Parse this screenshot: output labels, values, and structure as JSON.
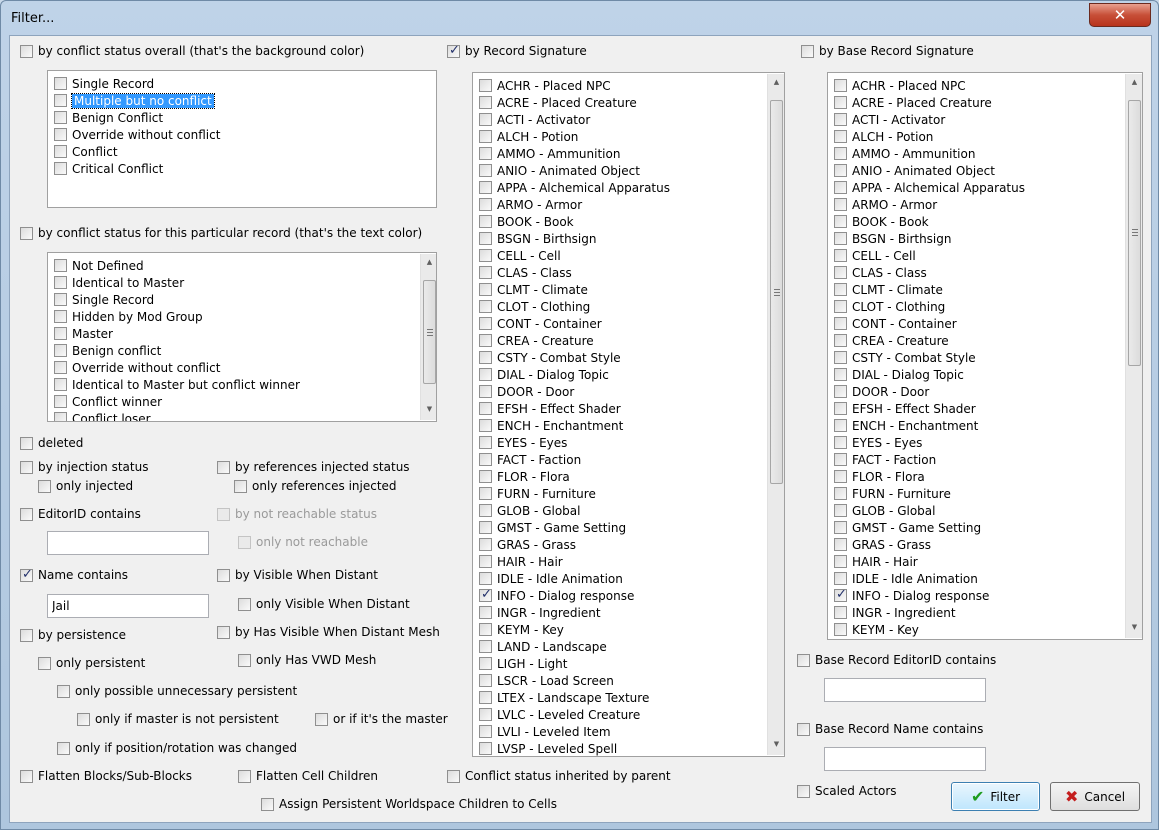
{
  "window": {
    "title": "Filter...",
    "close_glyph": "✕"
  },
  "conflict_overall": {
    "label": "by conflict status overall (that's the background color)",
    "checked": false,
    "items": [
      {
        "label": "Single Record",
        "selected": false
      },
      {
        "label": "Multiple but no conflict",
        "selected": true
      },
      {
        "label": "Benign Conflict",
        "selected": false
      },
      {
        "label": "Override without conflict",
        "selected": false
      },
      {
        "label": "Conflict",
        "selected": false
      },
      {
        "label": "Critical Conflict",
        "selected": false
      }
    ]
  },
  "conflict_record": {
    "label": "by conflict status for this particular record  (that's the text color)",
    "checked": false,
    "items": [
      "Not Defined",
      "Identical to Master",
      "Single Record",
      "Hidden by Mod Group",
      "Master",
      "Benign conflict",
      "Override without conflict",
      "Identical to Master but conflict winner",
      "Conflict winner",
      "Conflict loser"
    ]
  },
  "options": {
    "deleted": "deleted",
    "by_injection_status": "by injection status",
    "only_injected": "only injected",
    "by_references_injected": "by references injected status",
    "only_references_injected": "only references injected",
    "editorid_contains": "EditorID contains",
    "editorid_value": "",
    "by_not_reachable": "by not reachable status",
    "only_not_reachable": "only not reachable",
    "name_contains": "Name contains",
    "name_value": "Jail",
    "by_visible_when_distant": "by Visible When Distant",
    "only_visible_when_distant": "only Visible When Distant",
    "by_persistence": "by persistence",
    "by_has_vwd_mesh": "by Has Visible When Distant Mesh",
    "only_persistent": "only persistent",
    "only_has_vwd_mesh": "only Has VWD Mesh",
    "only_possible_unnecessary_persistent": "only possible unnecessary persistent",
    "only_if_master_not_persistent": "only if master is not persistent",
    "or_if_its_the_master": "or if it's the master",
    "only_if_position_changed": "only if position/rotation was changed",
    "flatten_blocks": "Flatten Blocks/Sub-Blocks",
    "flatten_cell_children": "Flatten Cell Children",
    "conflict_inherited": "Conflict status inherited by parent",
    "assign_persistent": "Assign Persistent Worldspace Children to Cells"
  },
  "record_signature": {
    "label": "by Record Signature",
    "checked": true,
    "items": [
      {
        "label": "ACHR - Placed NPC",
        "checked": false
      },
      {
        "label": "ACRE - Placed Creature",
        "checked": false
      },
      {
        "label": "ACTI - Activator",
        "checked": false
      },
      {
        "label": "ALCH - Potion",
        "checked": false
      },
      {
        "label": "AMMO - Ammunition",
        "checked": false
      },
      {
        "label": "ANIO - Animated Object",
        "checked": false
      },
      {
        "label": "APPA - Alchemical Apparatus",
        "checked": false
      },
      {
        "label": "ARMO - Armor",
        "checked": false
      },
      {
        "label": "BOOK - Book",
        "checked": false
      },
      {
        "label": "BSGN - Birthsign",
        "checked": false
      },
      {
        "label": "CELL - Cell",
        "checked": false
      },
      {
        "label": "CLAS - Class",
        "checked": false
      },
      {
        "label": "CLMT - Climate",
        "checked": false
      },
      {
        "label": "CLOT - Clothing",
        "checked": false
      },
      {
        "label": "CONT - Container",
        "checked": false
      },
      {
        "label": "CREA - Creature",
        "checked": false
      },
      {
        "label": "CSTY - Combat Style",
        "checked": false
      },
      {
        "label": "DIAL - Dialog Topic",
        "checked": false
      },
      {
        "label": "DOOR - Door",
        "checked": false
      },
      {
        "label": "EFSH - Effect Shader",
        "checked": false
      },
      {
        "label": "ENCH - Enchantment",
        "checked": false
      },
      {
        "label": "EYES - Eyes",
        "checked": false
      },
      {
        "label": "FACT - Faction",
        "checked": false
      },
      {
        "label": "FLOR - Flora",
        "checked": false
      },
      {
        "label": "FURN - Furniture",
        "checked": false
      },
      {
        "label": "GLOB - Global",
        "checked": false
      },
      {
        "label": "GMST - Game Setting",
        "checked": false
      },
      {
        "label": "GRAS - Grass",
        "checked": false
      },
      {
        "label": "HAIR - Hair",
        "checked": false
      },
      {
        "label": "IDLE - Idle Animation",
        "checked": false
      },
      {
        "label": "INFO - Dialog response",
        "checked": true
      },
      {
        "label": "INGR - Ingredient",
        "checked": false
      },
      {
        "label": "KEYM - Key",
        "checked": false
      },
      {
        "label": "LAND - Landscape",
        "checked": false
      },
      {
        "label": "LIGH - Light",
        "checked": false
      },
      {
        "label": "LSCR - Load Screen",
        "checked": false
      },
      {
        "label": "LTEX - Landscape Texture",
        "checked": false
      },
      {
        "label": "LVLC - Leveled Creature",
        "checked": false
      },
      {
        "label": "LVLI - Leveled Item",
        "checked": false
      },
      {
        "label": "LVSP - Leveled Spell",
        "checked": false
      }
    ]
  },
  "base_record_signature": {
    "label": "by Base Record Signature",
    "checked": false,
    "items": [
      {
        "label": "ACHR - Placed NPC",
        "checked": false
      },
      {
        "label": "ACRE - Placed Creature",
        "checked": false
      },
      {
        "label": "ACTI - Activator",
        "checked": false
      },
      {
        "label": "ALCH - Potion",
        "checked": false
      },
      {
        "label": "AMMO - Ammunition",
        "checked": false
      },
      {
        "label": "ANIO - Animated Object",
        "checked": false
      },
      {
        "label": "APPA - Alchemical Apparatus",
        "checked": false
      },
      {
        "label": "ARMO - Armor",
        "checked": false
      },
      {
        "label": "BOOK - Book",
        "checked": false
      },
      {
        "label": "BSGN - Birthsign",
        "checked": false
      },
      {
        "label": "CELL - Cell",
        "checked": false
      },
      {
        "label": "CLAS - Class",
        "checked": false
      },
      {
        "label": "CLMT - Climate",
        "checked": false
      },
      {
        "label": "CLOT - Clothing",
        "checked": false
      },
      {
        "label": "CONT - Container",
        "checked": false
      },
      {
        "label": "CREA - Creature",
        "checked": false
      },
      {
        "label": "CSTY - Combat Style",
        "checked": false
      },
      {
        "label": "DIAL - Dialog Topic",
        "checked": false
      },
      {
        "label": "DOOR - Door",
        "checked": false
      },
      {
        "label": "EFSH - Effect Shader",
        "checked": false
      },
      {
        "label": "ENCH - Enchantment",
        "checked": false
      },
      {
        "label": "EYES - Eyes",
        "checked": false
      },
      {
        "label": "FACT - Faction",
        "checked": false
      },
      {
        "label": "FLOR - Flora",
        "checked": false
      },
      {
        "label": "FURN - Furniture",
        "checked": false
      },
      {
        "label": "GLOB - Global",
        "checked": false
      },
      {
        "label": "GMST - Game Setting",
        "checked": false
      },
      {
        "label": "GRAS - Grass",
        "checked": false
      },
      {
        "label": "HAIR - Hair",
        "checked": false
      },
      {
        "label": "IDLE - Idle Animation",
        "checked": false
      },
      {
        "label": "INFO - Dialog response",
        "checked": true
      },
      {
        "label": "INGR - Ingredient",
        "checked": false
      },
      {
        "label": "KEYM - Key",
        "checked": false
      }
    ]
  },
  "base_options": {
    "base_editorid_contains": "Base Record EditorID contains",
    "base_editorid_value": "",
    "base_name_contains": "Base Record Name contains",
    "base_name_value": "",
    "scaled_actors": "Scaled Actors"
  },
  "buttons": {
    "filter": "Filter",
    "cancel": "Cancel",
    "filter_icon": "checkmark-icon",
    "cancel_icon": "x-icon"
  },
  "colors": {
    "selection": "#3399ff",
    "window_frame": "#bfd3e8",
    "close_button": "#c74f38"
  }
}
